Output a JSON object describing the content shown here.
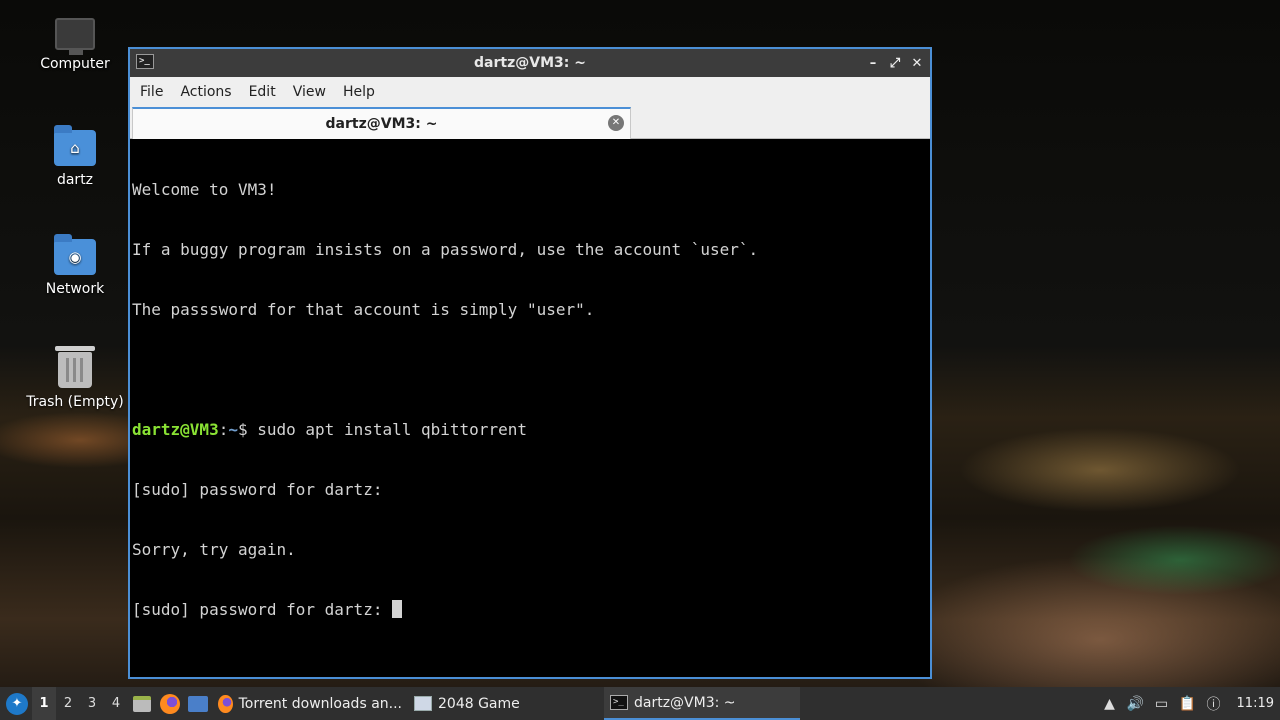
{
  "desktop": {
    "icons": [
      {
        "label": "Computer",
        "icon": "computer-icon"
      },
      {
        "label": "dartz",
        "icon": "home-folder-icon"
      },
      {
        "label": "Network",
        "icon": "network-folder-icon"
      },
      {
        "label": "Trash (Empty)",
        "icon": "trash-icon"
      }
    ]
  },
  "window": {
    "title": "dartz@VM3: ~",
    "controls": {
      "minimize": "–",
      "maximize": "⤢",
      "close": "✕"
    },
    "menu": [
      "File",
      "Actions",
      "Edit",
      "View",
      "Help"
    ],
    "tab": {
      "label": "dartz@VM3: ~",
      "close": "✕"
    },
    "terminal": {
      "welcome_lines": [
        "Welcome to VM3!",
        "If a buggy program insists on a password, use the account `user`.",
        "The passsword for that account is simply \"user\"."
      ],
      "prompt_user": "dartz@VM3",
      "prompt_sep": ":",
      "prompt_path": "~",
      "prompt_end": "$ ",
      "command": "sudo apt install qbittorrent",
      "output_lines": [
        "[sudo] password for dartz:",
        "Sorry, try again.",
        "[sudo] password for dartz: "
      ]
    }
  },
  "taskbar": {
    "workspaces": [
      "1",
      "2",
      "3",
      "4"
    ],
    "active_workspace": "1",
    "tasks": [
      {
        "label": "Torrent downloads an...",
        "icon": "firefox-icon"
      },
      {
        "label": "2048 Game",
        "icon": "window-icon"
      },
      {
        "label": "dartz@VM3: ~",
        "icon": "terminal-icon"
      }
    ],
    "clock": "11:19"
  },
  "colors": {
    "accent": "#4b8fd6",
    "prompt_user": "#8ae234",
    "prompt_path": "#729fcf",
    "terminal_bg": "#000000",
    "terminal_fg": "#d3d3d3"
  }
}
